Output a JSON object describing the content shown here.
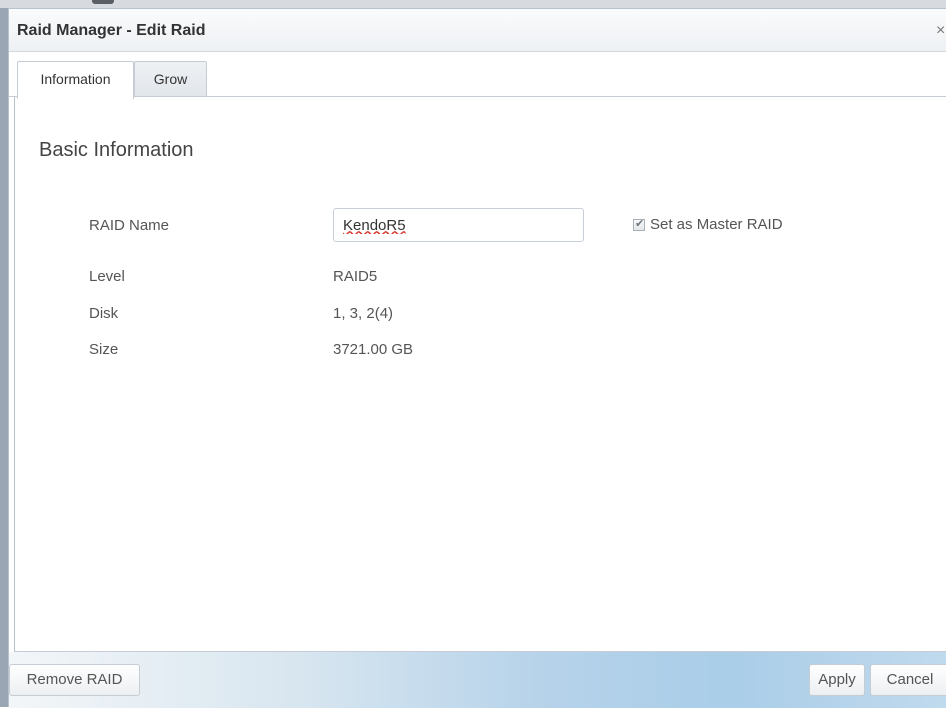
{
  "window": {
    "title": "Raid Manager - Edit Raid",
    "close_glyph": "×"
  },
  "tabs": [
    {
      "label": "Information",
      "active": true
    },
    {
      "label": "Grow",
      "active": false
    }
  ],
  "section": {
    "title": "Basic Information"
  },
  "fields": {
    "raid_name_label": "RAID Name",
    "raid_name_value": "KendoR5",
    "level_label": "Level",
    "level_value": "RAID5",
    "disk_label": "Disk",
    "disk_value": "1, 3, 2(4)",
    "size_label": "Size",
    "size_value": "3721.00 GB"
  },
  "master": {
    "label": "Set as Master RAID",
    "checked": true
  },
  "footer": {
    "remove_label": "Remove RAID",
    "apply_label": "Apply",
    "cancel_label": "Cancel"
  },
  "colors": {
    "footer_accent": "#aacde8",
    "spellcheck_underline": "#d9382e"
  },
  "icons": {
    "close": "close-icon",
    "check": "checkmark-icon"
  }
}
